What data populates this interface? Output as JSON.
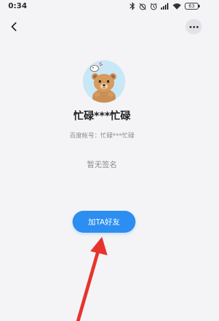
{
  "status_bar": {
    "time": "0:34",
    "battery_level": "63"
  },
  "profile": {
    "name": "忙碌***忙碌",
    "baidu_account": "百度帐号：忙碌***忙碌",
    "signature": "暂无签名"
  },
  "actions": {
    "add_friend_label": "加TA好友"
  },
  "icons": {
    "back": "chevron-left-icon",
    "more": "more-dots-icon",
    "annotation_arrow": "red-arrow"
  },
  "colors": {
    "background": "#f4f4f6",
    "accent": "#2b8ef0",
    "annotation": "#e8332d",
    "avatar_bg": "#c9e8f7"
  }
}
